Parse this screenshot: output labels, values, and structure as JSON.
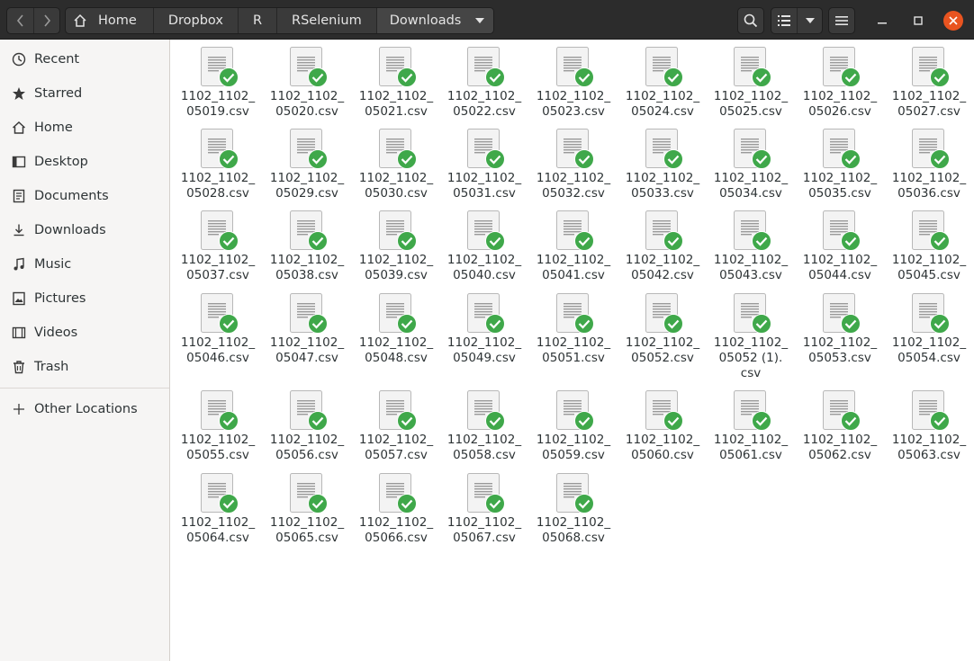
{
  "toolbar": {
    "back_icon": "chevron-left-icon",
    "forward_icon": "chevron-right-icon",
    "breadcrumbs": [
      "Home",
      "Dropbox",
      "R",
      "RSelenium",
      "Downloads"
    ],
    "search_icon": "search-icon",
    "view_icon": "list-view-icon",
    "menu_icon": "hamburger-menu-icon"
  },
  "window": {
    "close_color": "#e95420"
  },
  "sidebar": {
    "items": [
      {
        "label": "Recent",
        "icon": "clock-icon"
      },
      {
        "label": "Starred",
        "icon": "star-icon"
      },
      {
        "label": "Home",
        "icon": "home-icon"
      },
      {
        "label": "Desktop",
        "icon": "desktop-icon"
      },
      {
        "label": "Documents",
        "icon": "document-icon"
      },
      {
        "label": "Downloads",
        "icon": "download-icon"
      },
      {
        "label": "Music",
        "icon": "music-icon"
      },
      {
        "label": "Pictures",
        "icon": "picture-icon"
      },
      {
        "label": "Videos",
        "icon": "video-icon"
      },
      {
        "label": "Trash",
        "icon": "trash-icon"
      }
    ],
    "other": {
      "label": "Other Locations",
      "icon": "plus-icon"
    }
  },
  "files": [
    {
      "line1": "1102_1102_",
      "line2": "05019.csv"
    },
    {
      "line1": "1102_1102_",
      "line2": "05020.csv"
    },
    {
      "line1": "1102_1102_",
      "line2": "05021.csv"
    },
    {
      "line1": "1102_1102_",
      "line2": "05022.csv"
    },
    {
      "line1": "1102_1102_",
      "line2": "05023.csv"
    },
    {
      "line1": "1102_1102_",
      "line2": "05024.csv"
    },
    {
      "line1": "1102_1102_",
      "line2": "05025.csv"
    },
    {
      "line1": "1102_1102_",
      "line2": "05026.csv"
    },
    {
      "line1": "1102_1102_",
      "line2": "05027.csv"
    },
    {
      "line1": "1102_1102_",
      "line2": "05028.csv"
    },
    {
      "line1": "1102_1102_",
      "line2": "05029.csv"
    },
    {
      "line1": "1102_1102_",
      "line2": "05030.csv"
    },
    {
      "line1": "1102_1102_",
      "line2": "05031.csv"
    },
    {
      "line1": "1102_1102_",
      "line2": "05032.csv"
    },
    {
      "line1": "1102_1102_",
      "line2": "05033.csv"
    },
    {
      "line1": "1102_1102_",
      "line2": "05034.csv"
    },
    {
      "line1": "1102_1102_",
      "line2": "05035.csv"
    },
    {
      "line1": "1102_1102_",
      "line2": "05036.csv"
    },
    {
      "line1": "1102_1102_",
      "line2": "05037.csv"
    },
    {
      "line1": "1102_1102_",
      "line2": "05038.csv"
    },
    {
      "line1": "1102_1102_",
      "line2": "05039.csv"
    },
    {
      "line1": "1102_1102_",
      "line2": "05040.csv"
    },
    {
      "line1": "1102_1102_",
      "line2": "05041.csv"
    },
    {
      "line1": "1102_1102_",
      "line2": "05042.csv"
    },
    {
      "line1": "1102_1102_",
      "line2": "05043.csv"
    },
    {
      "line1": "1102_1102_",
      "line2": "05044.csv"
    },
    {
      "line1": "1102_1102_",
      "line2": "05045.csv"
    },
    {
      "line1": "1102_1102_",
      "line2": "05046.csv"
    },
    {
      "line1": "1102_1102_",
      "line2": "05047.csv"
    },
    {
      "line1": "1102_1102_",
      "line2": "05048.csv"
    },
    {
      "line1": "1102_1102_",
      "line2": "05049.csv"
    },
    {
      "line1": "1102_1102_",
      "line2": "05051.csv"
    },
    {
      "line1": "1102_1102_",
      "line2": "05052.csv"
    },
    {
      "line1": "1102_1102_",
      "line2": "05052 (1).",
      "line3": "csv"
    },
    {
      "line1": "1102_1102_",
      "line2": "05053.csv"
    },
    {
      "line1": "1102_1102_",
      "line2": "05054.csv"
    },
    {
      "line1": "1102_1102_",
      "line2": "05055.csv"
    },
    {
      "line1": "1102_1102_",
      "line2": "05056.csv"
    },
    {
      "line1": "1102_1102_",
      "line2": "05057.csv"
    },
    {
      "line1": "1102_1102_",
      "line2": "05058.csv"
    },
    {
      "line1": "1102_1102_",
      "line2": "05059.csv"
    },
    {
      "line1": "1102_1102_",
      "line2": "05060.csv"
    },
    {
      "line1": "1102_1102_",
      "line2": "05061.csv"
    },
    {
      "line1": "1102_1102_",
      "line2": "05062.csv"
    },
    {
      "line1": "1102_1102_",
      "line2": "05063.csv"
    },
    {
      "line1": "1102_1102_",
      "line2": "05064.csv"
    },
    {
      "line1": "1102_1102_",
      "line2": "05065.csv"
    },
    {
      "line1": "1102_1102_",
      "line2": "05066.csv"
    },
    {
      "line1": "1102_1102_",
      "line2": "05067.csv"
    },
    {
      "line1": "1102_1102_",
      "line2": "05068.csv"
    }
  ],
  "file_icon": "spreadsheet-file-icon",
  "emblem_icon": "synced-checkmark-icon",
  "emblem_color": "#3fa84a"
}
